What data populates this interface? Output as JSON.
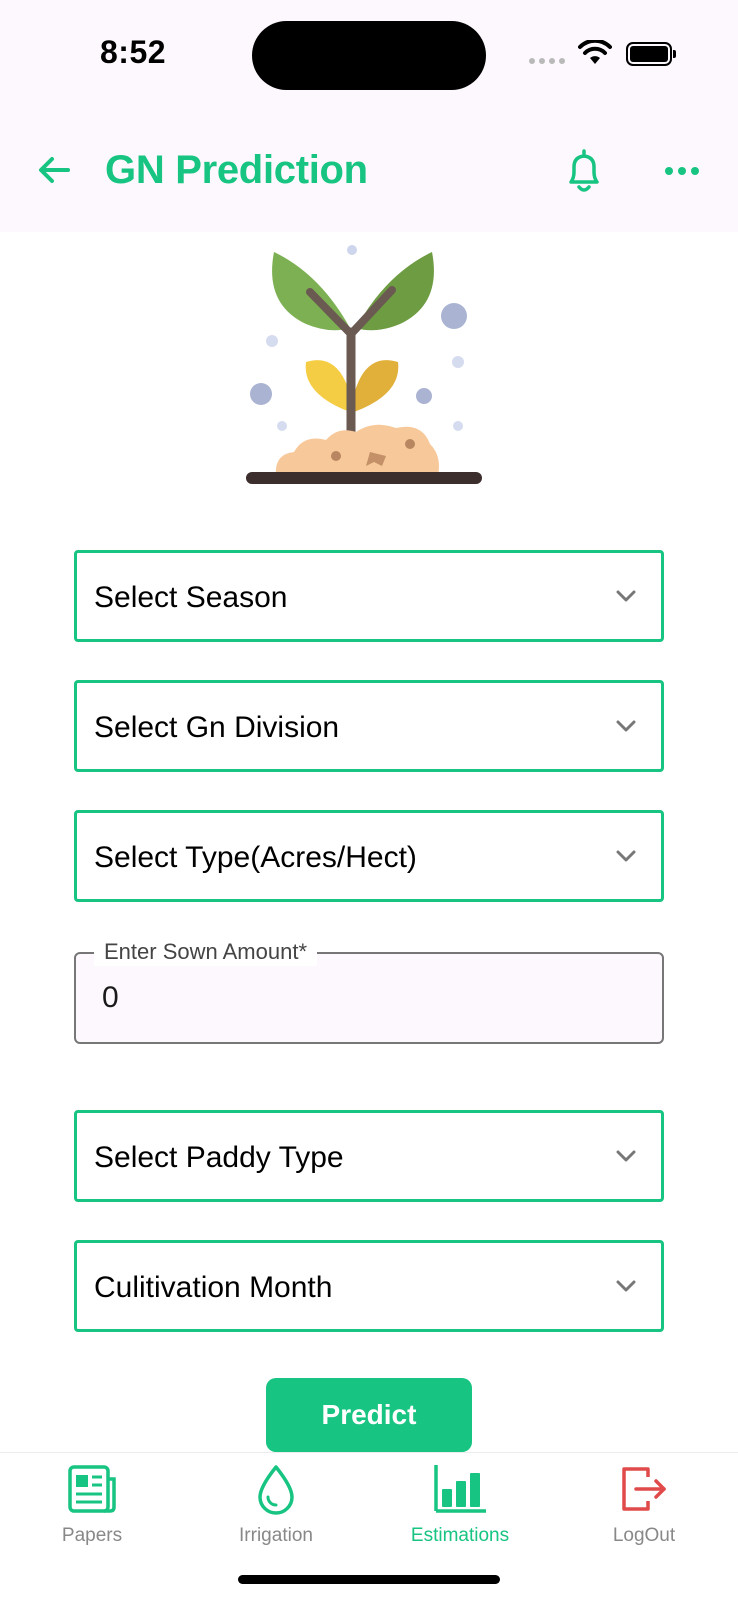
{
  "status_bar": {
    "time": "8:52"
  },
  "app_bar": {
    "title": "GN Prediction",
    "back_icon": "arrow-left-icon",
    "bell_icon": "bell-icon",
    "more_icon": "more-horizontal-icon"
  },
  "illustration": {
    "icon": "sprouting-plant-illustration"
  },
  "form": {
    "season_label": "Select Season",
    "gn_division_label": "Select Gn Division",
    "type_label": "Select Type(Acres/Hect)",
    "sown_amount": {
      "label": "Enter Sown Amount*",
      "value": "0"
    },
    "paddy_type_label": "Select Paddy Type",
    "cultivation_month_label": "Culitivation Month",
    "predict_label": "Predict"
  },
  "bottom_nav": {
    "items": [
      {
        "label": "Papers",
        "icon": "newspaper-icon",
        "active": false
      },
      {
        "label": "Irrigation",
        "icon": "water-drop-icon",
        "active": false
      },
      {
        "label": "Estimations",
        "icon": "bar-chart-icon",
        "active": true
      },
      {
        "label": "LogOut",
        "icon": "logout-icon",
        "active": false
      }
    ]
  },
  "colors": {
    "accent": "#17c481",
    "logout": "#e04a4a",
    "inactive_label": "#888888",
    "app_bar_bg": "#fdf8fd"
  }
}
